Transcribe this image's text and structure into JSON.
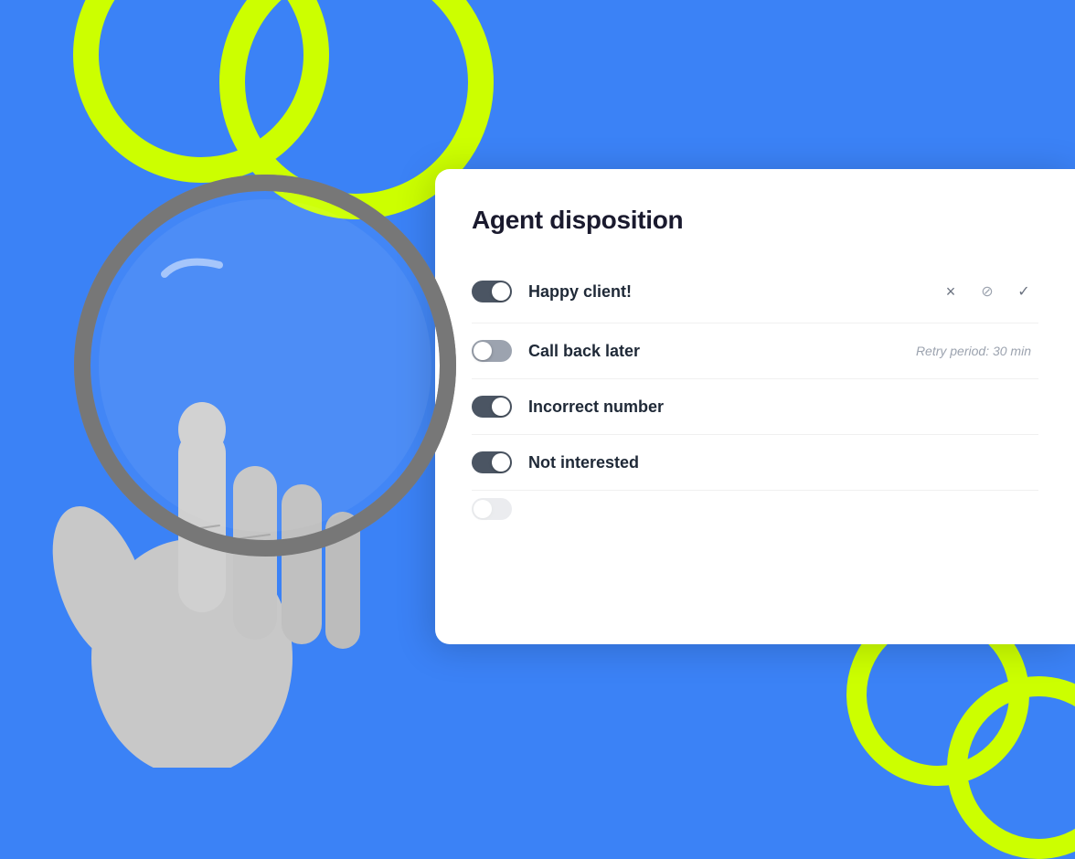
{
  "background": {
    "color": "#3B82F6"
  },
  "card": {
    "title": "Agent disposition",
    "dispositions": [
      {
        "id": "happy-client",
        "label": "Happy client!",
        "active": true,
        "editing": true,
        "retry_period": null
      },
      {
        "id": "call-back-later",
        "label": "Call back later",
        "active": false,
        "editing": false,
        "retry_period": "Retry period: 30 min"
      },
      {
        "id": "incorrect-number",
        "label": "Incorrect number",
        "active": true,
        "editing": false,
        "retry_period": null
      },
      {
        "id": "not-interested",
        "label": "Not interested",
        "active": true,
        "editing": false,
        "retry_period": null
      }
    ]
  },
  "actions": {
    "close_label": "×",
    "ban_label": "⊘",
    "check_label": "✓"
  }
}
